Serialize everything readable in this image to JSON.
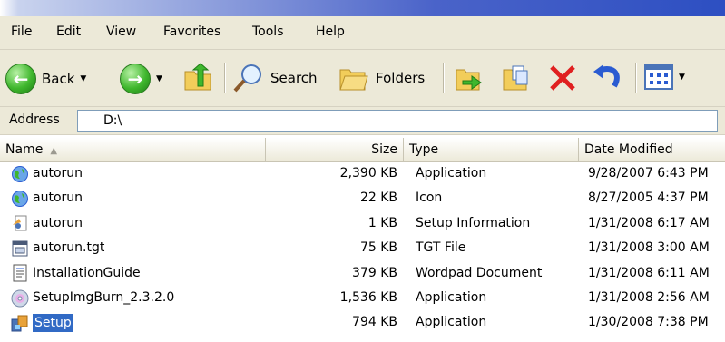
{
  "menu": [
    "File",
    "Edit",
    "View",
    "Favorites",
    "Tools",
    "Help"
  ],
  "toolbar": {
    "back_label": "Back",
    "search_label": "Search",
    "folders_label": "Folders"
  },
  "address": {
    "label": "Address",
    "value": "D:\\"
  },
  "columns": {
    "name": "Name",
    "size": "Size",
    "type": "Type",
    "date": "Date Modified"
  },
  "files": [
    {
      "name": "autorun",
      "size": "2,390 KB",
      "type": "Application",
      "date": "9/28/2007 6:43 PM",
      "icon": "globe-icon"
    },
    {
      "name": "autorun",
      "size": "22 KB",
      "type": "Icon",
      "date": "8/27/2005 4:37 PM",
      "icon": "globe-icon"
    },
    {
      "name": "autorun",
      "size": "1 KB",
      "type": "Setup Information",
      "date": "1/31/2008 6:17 AM",
      "icon": "setup-info-icon"
    },
    {
      "name": "autorun.tgt",
      "size": "75 KB",
      "type": "TGT File",
      "date": "1/31/2008 3:00 AM",
      "icon": "generic-file-icon"
    },
    {
      "name": "InstallationGuide",
      "size": "379 KB",
      "type": "Wordpad Document",
      "date": "1/31/2008 6:11 AM",
      "icon": "wordpad-icon"
    },
    {
      "name": "SetupImgBurn_2.3.2.0",
      "size": "1,536 KB",
      "type": "Application",
      "date": "1/31/2008 2:56 AM",
      "icon": "disc-icon"
    },
    {
      "name": "Setup",
      "size": "794 KB",
      "type": "Application",
      "date": "1/30/2008 7:38 PM",
      "icon": "setup-app-icon"
    }
  ],
  "selected_index": 6
}
